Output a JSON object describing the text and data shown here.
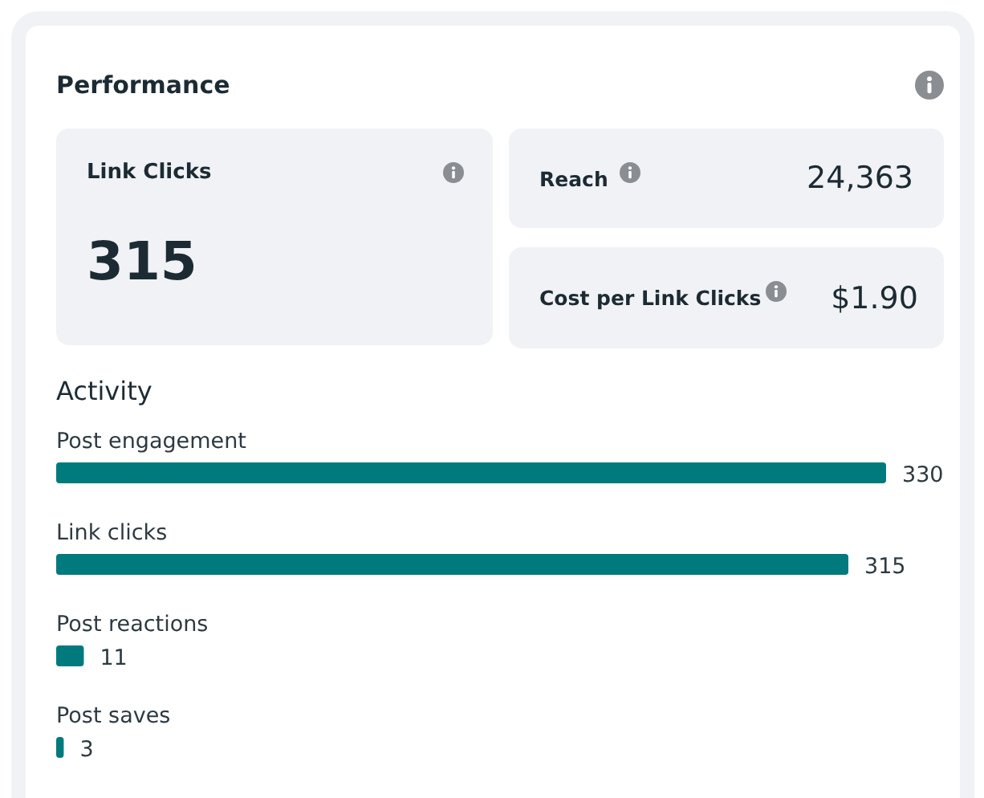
{
  "card": {
    "title": "Performance"
  },
  "metrics": [
    {
      "label": "Link Clicks",
      "value": "315"
    },
    {
      "label": "Reach",
      "value": "24,363"
    },
    {
      "label": "Cost per Link Clicks",
      "value": "$1.90"
    }
  ],
  "activity": {
    "title": "Activity",
    "chart_data": {
      "type": "bar",
      "orientation": "horizontal",
      "categories": [
        "Post engagement",
        "Link clicks",
        "Post reactions",
        "Post saves"
      ],
      "values": [
        330,
        315,
        11,
        3
      ],
      "data_labels": true
    }
  }
}
